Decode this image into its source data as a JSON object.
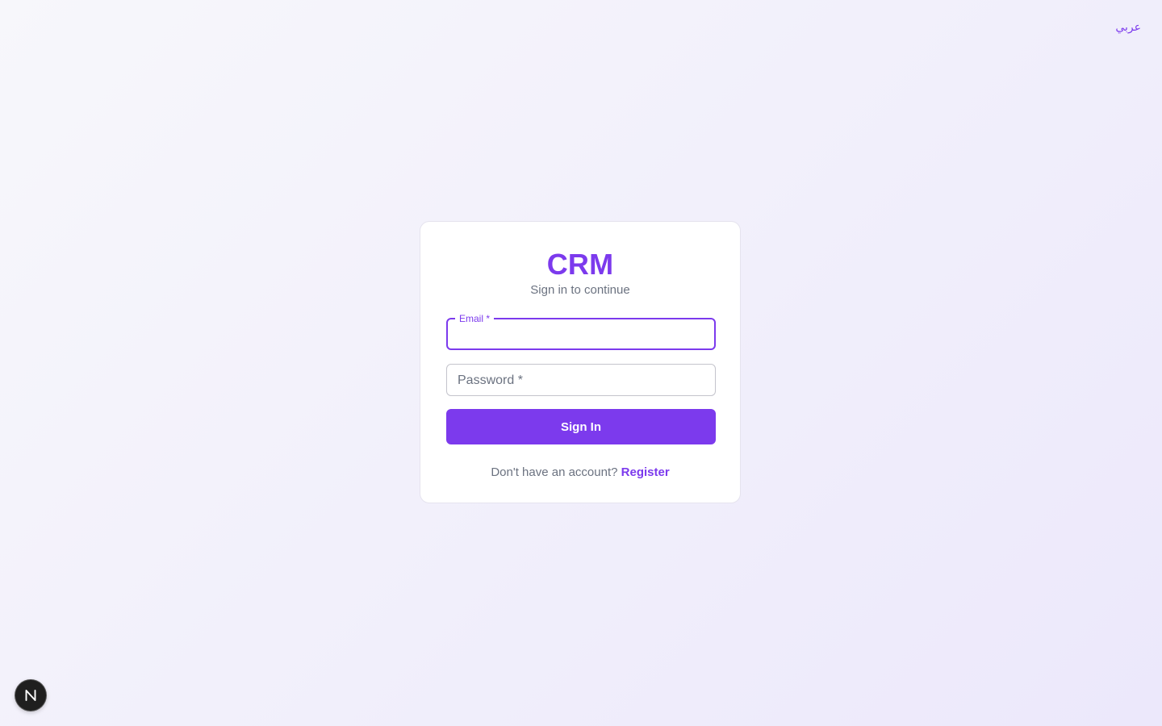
{
  "header": {
    "language_switch": "عربي"
  },
  "login": {
    "brand": "CRM",
    "subtitle": "Sign in to continue",
    "email_label": "Email *",
    "email_value": "",
    "password_label": "Password *",
    "password_value": "",
    "submit_label": "Sign In",
    "register_prompt": "Don't have an account?",
    "register_link": "Register"
  },
  "dev_badge": {
    "icon": "nextjs-n-icon"
  },
  "colors": {
    "accent": "#7c3aed",
    "muted_text": "#6b7280",
    "card_bg": "#ffffff",
    "page_bg": "#f3f1fb"
  }
}
